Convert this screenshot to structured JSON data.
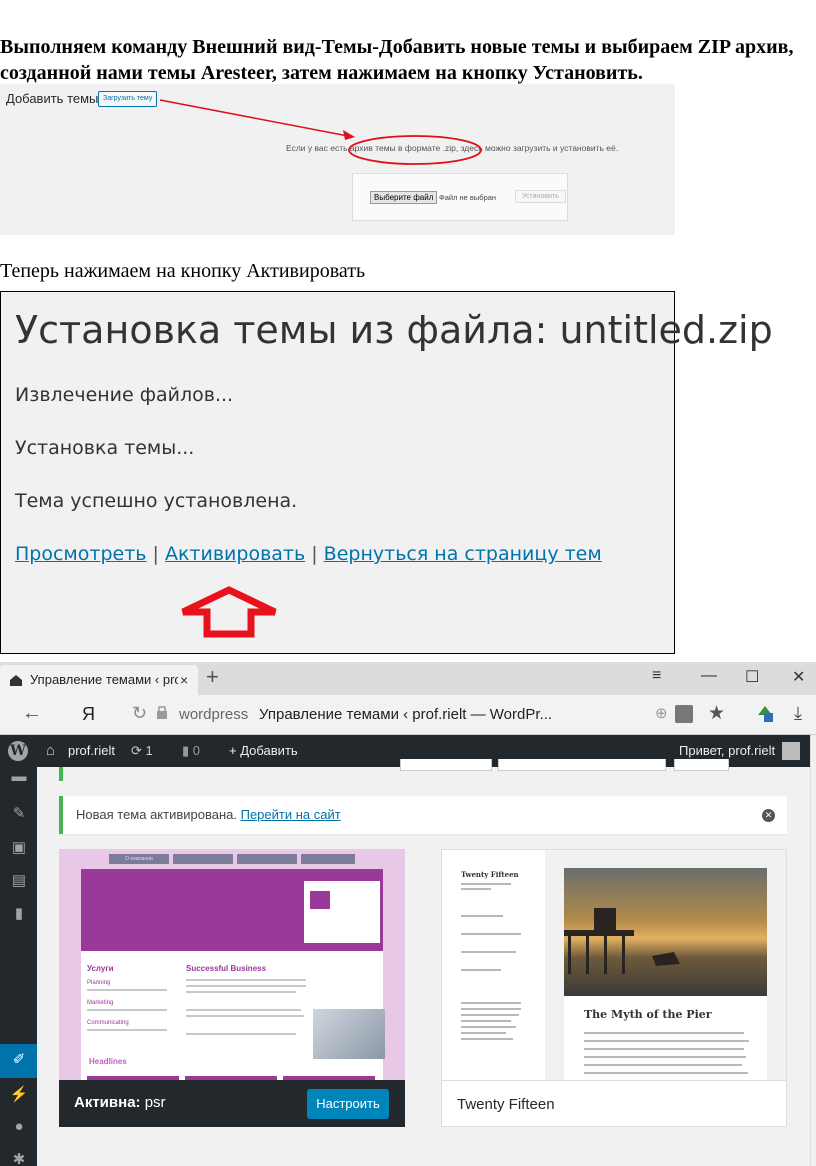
{
  "doc": {
    "para1": "Выполняем команду Внешний вид-Темы-Добавить новые темы и выбираем ZIP архив, созданной нами темы Aresteer, затем нажимаем на кнопку Установить.",
    "para2": "Теперь нажимаем на кнопку Активировать"
  },
  "shot1": {
    "title": "Добавить темы",
    "upload_button": "Загрузить тему",
    "hint_before": "Если у вас есть ",
    "hint_highlight": "архив темы в формате .zip,",
    "hint_after": " здесь можно загрузить и установить её.",
    "choose_file": "Выберите файл",
    "no_file": "Файл не выбран",
    "install_button": "Установить",
    "annotation_color": "#e0101a"
  },
  "shot2": {
    "heading": "Установка темы из файла: untitled.zip",
    "step1": "Извлечение файлов...",
    "step2": "Установка темы...",
    "step3": "Тема успешно установлена.",
    "link_preview": "Просмотреть",
    "link_activate": "Активировать",
    "link_back": "Вернуться на страницу тем",
    "sep": " | ",
    "arrow_color": "#e8121c"
  },
  "shot3": {
    "tab_title": "Управление темами ‹ prof",
    "tab_close": "×",
    "new_tab": "+",
    "win_menu": "≡",
    "win_min": "—",
    "win_max": "☐",
    "win_close": "✕",
    "browser_logo": "Я",
    "domain": "wordpress",
    "page_title": "Управление темами ‹ prof.rielt — WordPr...",
    "admin": {
      "site": "prof.rielt",
      "updates": "1",
      "comments": "0",
      "add": "Добавить",
      "greeting": "Привет, prof.rielt"
    },
    "notice_text": "Новая тема активирована. ",
    "notice_link": "Перейти на сайт",
    "active_theme": {
      "label": "Активна:",
      "name": "psr",
      "customize": "Настроить",
      "nav_item": "О компании",
      "section_services": "Услуги",
      "section_business": "Successful Business",
      "item_planning": "Planning",
      "item_marketing": "Marketing",
      "item_communicating": "Communicating",
      "headlines": "Headlines"
    },
    "theme2": {
      "name": "Twenty Fifteen",
      "post_title": "The Myth of the Pier",
      "sidebar_title": "Twenty Fifteen"
    },
    "colors": {
      "admin_bar": "#23282d",
      "accent": "#0073aa",
      "notice_green": "#46b450",
      "button": "#0085ba",
      "psr_purple": "#9a3a98"
    }
  }
}
